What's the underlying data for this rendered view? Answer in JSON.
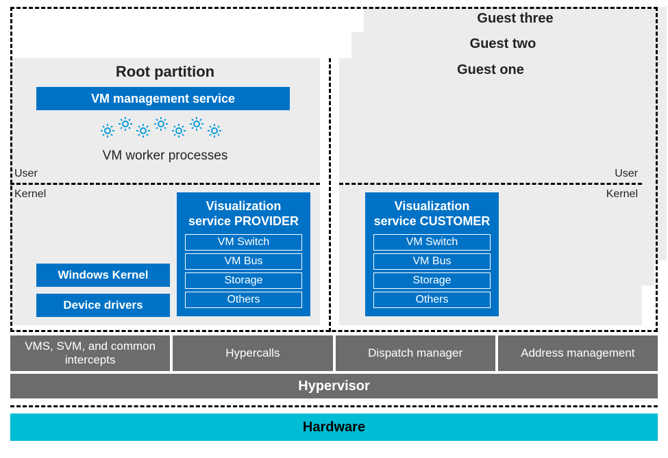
{
  "root": {
    "title": "Root partition",
    "vm_mgmt": "VM management service",
    "worker_processes": "VM worker processes",
    "user_label": "User",
    "kernel_label": "Kernel",
    "windows_kernel": "Windows Kernel",
    "device_drivers": "Device drivers",
    "viz": {
      "title": "Visualization service PROVIDER",
      "items": [
        "VM Switch",
        "VM Bus",
        "Storage",
        "Others"
      ]
    }
  },
  "guests": {
    "g1": "Guest one",
    "g2": "Guest two",
    "g3": "Guest three",
    "user_label": "User",
    "kernel_label": "Kernel",
    "viz": {
      "title": "Visualization service CUSTOMER",
      "items": [
        "VM Switch",
        "VM Bus",
        "Storage",
        "Others"
      ]
    }
  },
  "hypervisor": {
    "cells": {
      "c1": "VMS, SVM, and common intercepts",
      "c2": "Hypercalls",
      "c3": "Dispatch manager",
      "c4": "Address management"
    },
    "label": "Hypervisor"
  },
  "hardware": "Hardware",
  "icons": {
    "gear": "gear-icon"
  },
  "colors": {
    "brand_blue": "#0072c6",
    "light_gray": "#ececec",
    "dark_gray": "#6c6c6c",
    "cyan": "#00bcd4"
  }
}
